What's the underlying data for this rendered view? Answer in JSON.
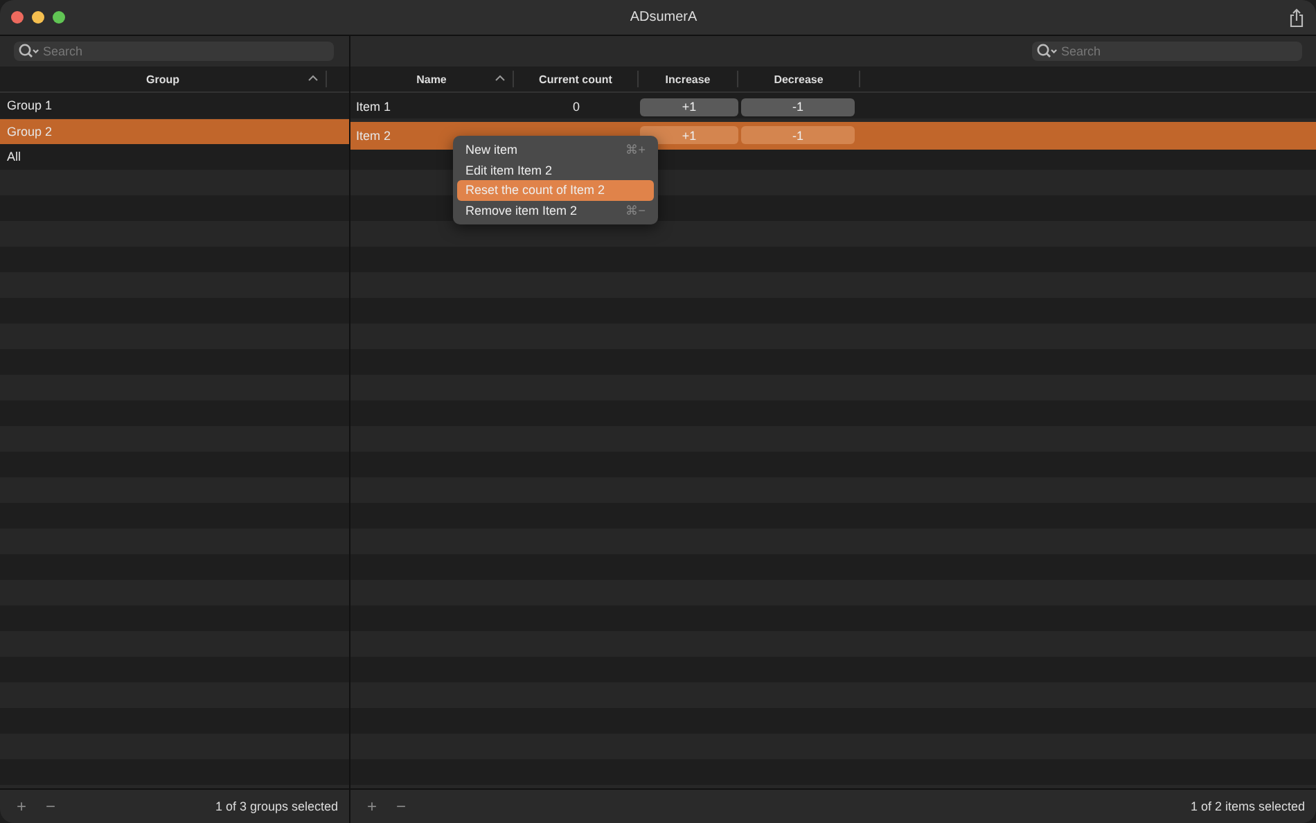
{
  "window": {
    "title": "ADsumerA"
  },
  "groups_pane": {
    "search": {
      "placeholder": "Search"
    },
    "columns": [
      {
        "label": "Group",
        "sorted": true
      }
    ],
    "rows": [
      {
        "name": "Group 1",
        "selected": false
      },
      {
        "name": "Group 2",
        "selected": true
      },
      {
        "name": "All",
        "selected": false
      }
    ],
    "footer": {
      "add": "+",
      "remove": "−",
      "status": "1 of 3 groups selected"
    }
  },
  "items_pane": {
    "search": {
      "placeholder": "Search"
    },
    "columns": [
      {
        "label": "Name",
        "sorted": true
      },
      {
        "label": "Current count",
        "sorted": false
      },
      {
        "label": "Increase",
        "sorted": false
      },
      {
        "label": "Decrease",
        "sorted": false
      }
    ],
    "rows": [
      {
        "name": "Item 1",
        "count": "0",
        "increase": "+1",
        "decrease": "-1",
        "selected": false
      },
      {
        "name": "Item 2",
        "increase": "+1",
        "decrease": "-1",
        "selected": true
      }
    ],
    "footer": {
      "add": "+",
      "remove": "−",
      "status": "1 of 2 items selected"
    }
  },
  "context_menu": {
    "items": [
      {
        "label": "New item",
        "shortcut": "⌘+",
        "selected": false
      },
      {
        "label": "Edit item Item 2",
        "selected": false
      },
      {
        "label": "Reset the count of Item 2",
        "selected": true
      },
      {
        "label": "Remove item Item 2",
        "shortcut": "⌘−",
        "selected": false
      }
    ]
  }
}
